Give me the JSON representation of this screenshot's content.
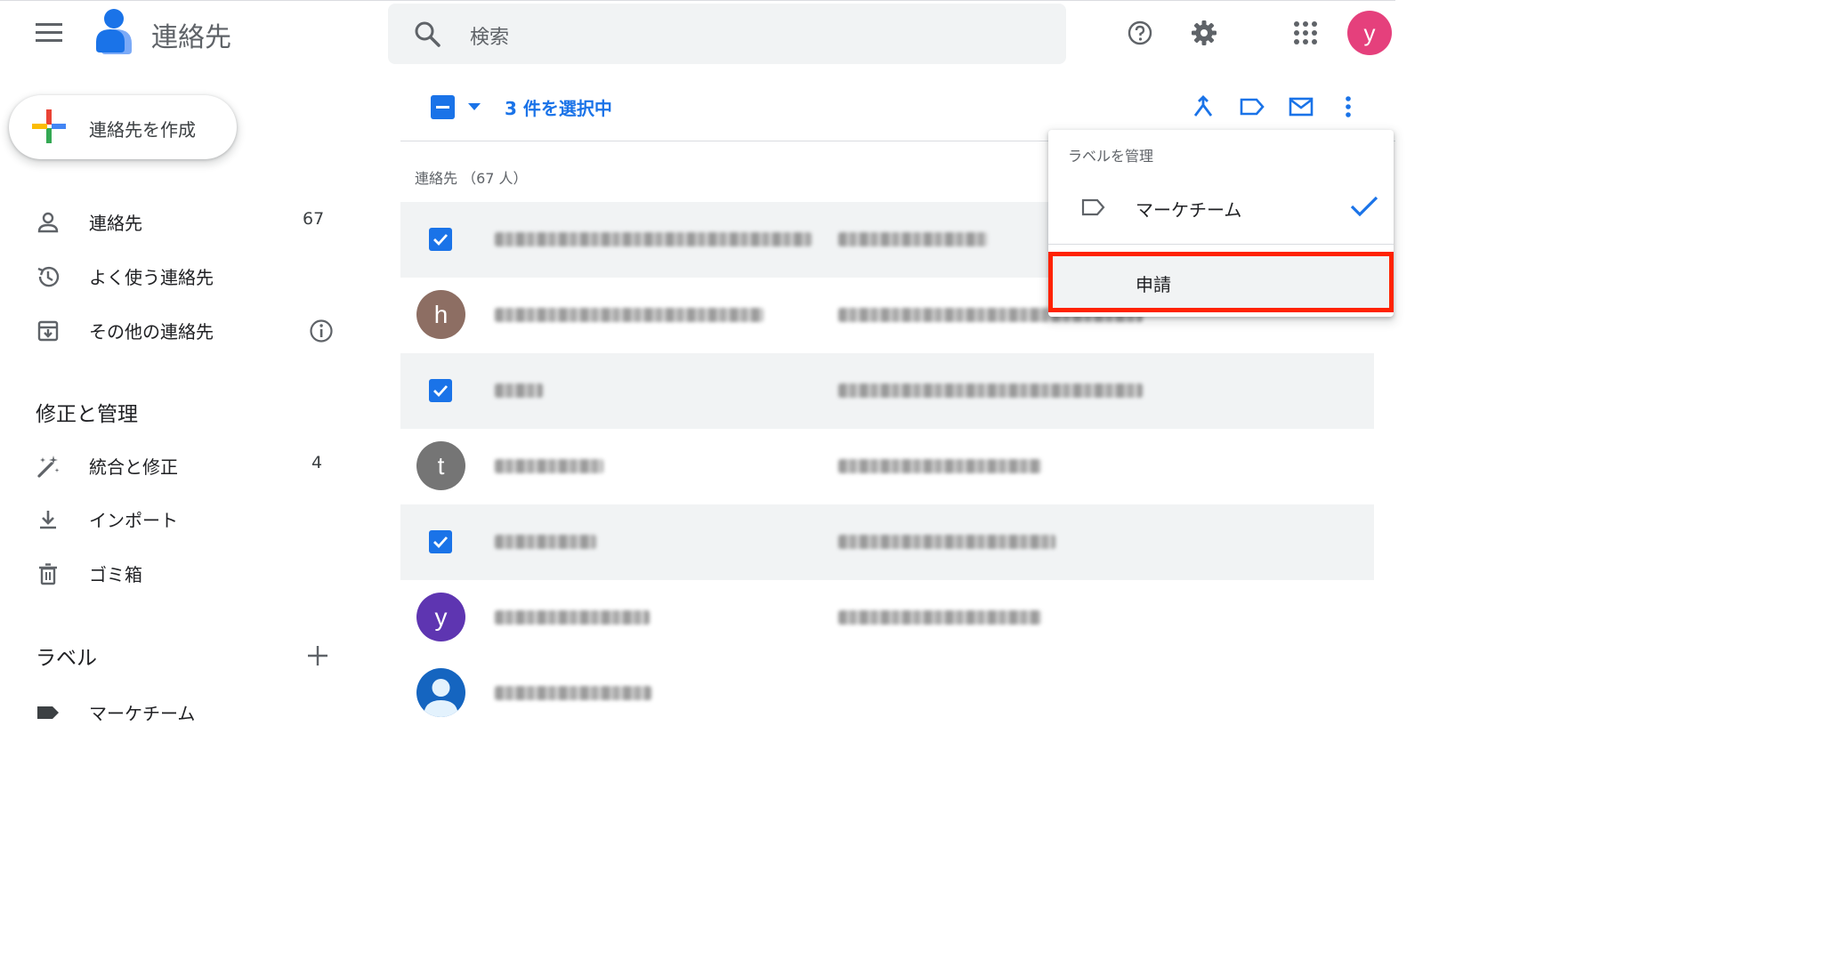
{
  "header": {
    "app_title": "連絡先",
    "search_placeholder": "検索",
    "avatar_letter": "y",
    "avatar_color": "#e5407c"
  },
  "sidebar": {
    "create_label": "連絡先を作成",
    "items": [
      {
        "label": "連絡先",
        "count": "67",
        "icon": "person-icon"
      },
      {
        "label": "よく使う連絡先",
        "count": "",
        "icon": "history-icon"
      },
      {
        "label": "その他の連絡先",
        "count": "",
        "icon": "archive-icon"
      }
    ],
    "section_fix": "修正と管理",
    "fix_items": [
      {
        "label": "統合と修正",
        "count": "4",
        "icon": "magic-wand-icon"
      },
      {
        "label": "インポート",
        "count": "",
        "icon": "download-icon"
      },
      {
        "label": "ゴミ箱",
        "count": "",
        "icon": "trash-icon"
      }
    ],
    "section_labels": "ラベル",
    "labels": [
      {
        "label": "マーケチーム",
        "icon": "label-icon"
      }
    ]
  },
  "toolbar": {
    "selected_text": "3 件を選択中"
  },
  "list": {
    "count_header": "連絡先 （67 人）",
    "rows": [
      {
        "selected": true,
        "avatar": "",
        "avatar_color": ""
      },
      {
        "selected": false,
        "avatar": "h",
        "avatar_color": "#8d6e63"
      },
      {
        "selected": true,
        "avatar": "",
        "avatar_color": ""
      },
      {
        "selected": false,
        "avatar": "t",
        "avatar_color": "#757575"
      },
      {
        "selected": true,
        "avatar": "",
        "avatar_color": ""
      },
      {
        "selected": false,
        "avatar": "y",
        "avatar_color": "#5e35b1"
      },
      {
        "selected": false,
        "avatar": "",
        "avatar_color": "#1565c0"
      }
    ]
  },
  "label_menu": {
    "header": "ラベルを管理",
    "items": [
      {
        "label": "マーケチーム",
        "checked": true
      },
      {
        "label": "申請",
        "checked": false
      }
    ]
  },
  "colors": {
    "accent": "#1a73e8",
    "highlight_border": "#ff2200"
  }
}
